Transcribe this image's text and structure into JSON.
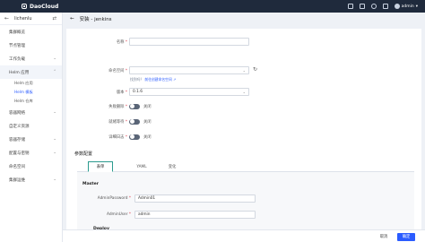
{
  "brand": {
    "name": "DaoCloud"
  },
  "topbar": {
    "user": "admin"
  },
  "sidebar": {
    "cluster": "lichenlu",
    "items": [
      {
        "label": "集群概览"
      },
      {
        "label": "节点管理"
      },
      {
        "label": "工作负载"
      },
      {
        "label": "Helm 应用"
      },
      {
        "label": "容器网络"
      },
      {
        "label": "自定义资源"
      },
      {
        "label": "容器存储"
      },
      {
        "label": "配置与密钥"
      },
      {
        "label": "命名空间"
      },
      {
        "label": "集群运维"
      }
    ],
    "helm_sub": [
      {
        "label": "Helm 应用"
      },
      {
        "label": "Helm 模板"
      },
      {
        "label": "Helm 仓库"
      }
    ]
  },
  "page": {
    "title": "安装 - jenkins"
  },
  "form": {
    "name_label": "名称",
    "namespace_label": "命名空间",
    "namespace_hint": "找到吗？",
    "namespace_hint_link": "前往创建命名空间",
    "version_label": "版本",
    "version_value": "0.1.6",
    "fail_delete_label": "失败删除",
    "ready_wait_label": "就绪等待",
    "detail_log_label": "详细日志",
    "toggle_off": "关闭",
    "params_title": "参数配置",
    "tabs": [
      {
        "label": "表单"
      },
      {
        "label": "YAML"
      },
      {
        "label": "变化"
      }
    ],
    "group_master": "Master",
    "admin_password_label": "AdminPassword",
    "admin_password_value": "Admin01",
    "admin_user_label": "AdminUser",
    "admin_user_value": "admin",
    "group_deploy": "Deploy"
  },
  "footer": {
    "cancel": "取消",
    "ok": "确定"
  },
  "colors": {
    "accent": "#2b5cff",
    "topbar": "#1f2a3c",
    "tab_border": "#2b9b8f"
  }
}
